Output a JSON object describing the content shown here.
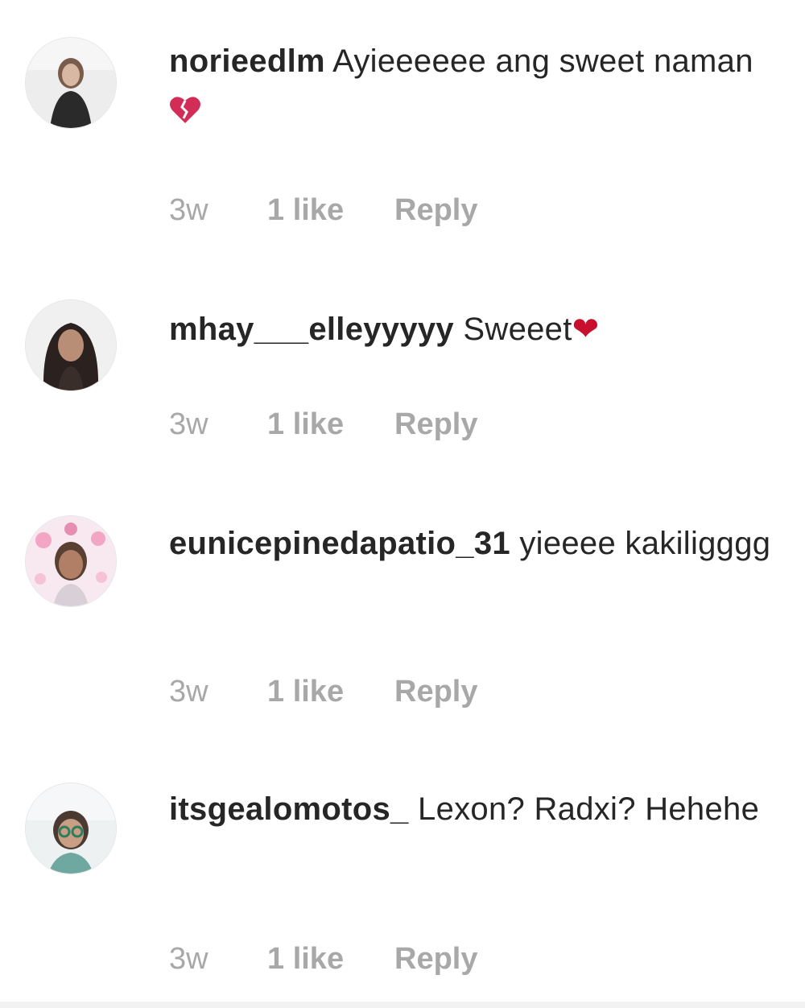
{
  "comments": [
    {
      "username": "norieedlm",
      "text": "Ayieeeeee ang sweet naman",
      "emoji": "broken-heart-icon",
      "time": "3w",
      "likes": "1 like",
      "reply": "Reply"
    },
    {
      "username": "mhay___elleyyyyy",
      "text": "Sweeet",
      "emoji": "heart-icon",
      "time": "3w",
      "likes": "1 like",
      "reply": "Reply"
    },
    {
      "username": "eunicepinedapatio_31",
      "text": "yieeee kakiligggg",
      "time": "3w",
      "likes": "1 like",
      "reply": "Reply"
    },
    {
      "username": "itsgealomotos_",
      "text": "Lexon? Radxi? Hehehe",
      "time": "3w",
      "likes": "1 like",
      "reply": "Reply"
    }
  ],
  "colors": {
    "text": "#262626",
    "meta": "#a8a8a8",
    "heart": "#c8102e"
  }
}
